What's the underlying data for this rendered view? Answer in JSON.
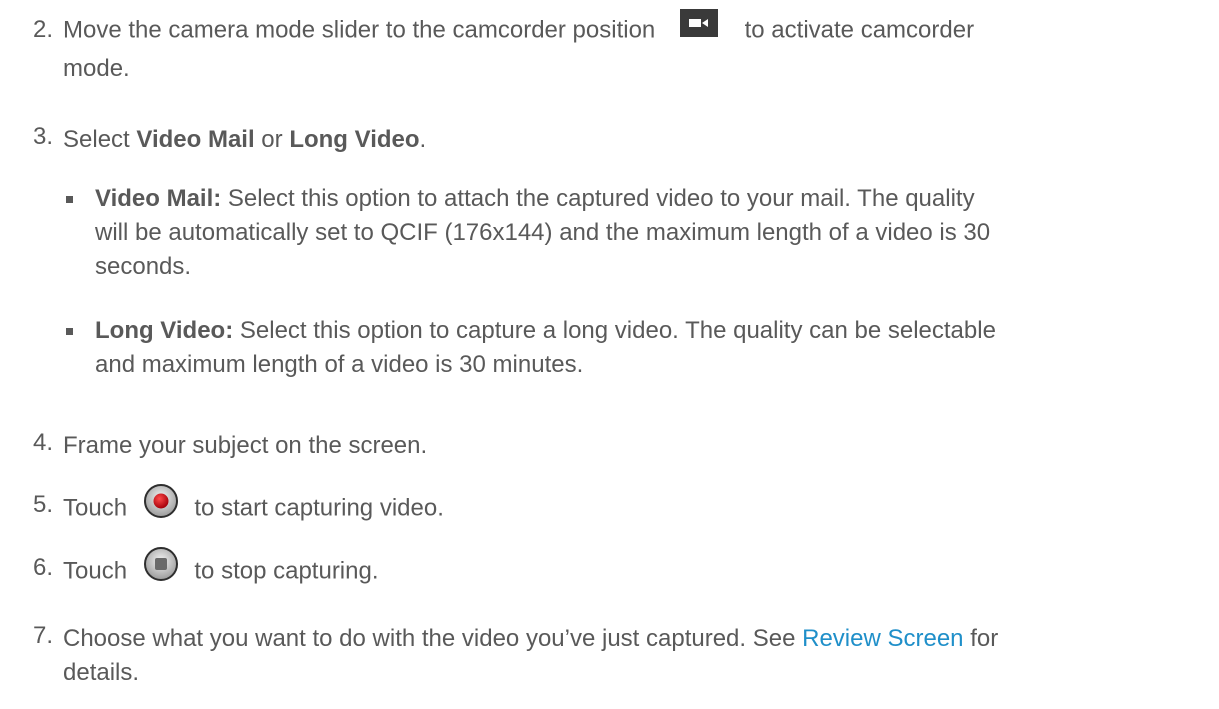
{
  "steps": [
    {
      "num": "2.",
      "pre": "Move the camera mode slider to the camcorder position",
      "post": "to activate camcorder",
      "line2": "mode.",
      "icon": "camcorder-icon"
    },
    {
      "num": "3.",
      "pre": "Select ",
      "b1": "Video Mail",
      "mid": " or ",
      "b2": "Long Video",
      "post": "."
    },
    {
      "num": "4.",
      "text": "Frame your subject on the screen."
    },
    {
      "num": "5.",
      "pre": "Touch",
      "post": "to start capturing video.",
      "icon": "record-button-icon"
    },
    {
      "num": "6.",
      "pre": "Touch",
      "post": "to stop capturing.",
      "icon": "stop-button-icon"
    },
    {
      "num": "7.",
      "line1": "Choose what you want to do with the video you’ve just captured. See ",
      "link": "Review Screen",
      "line1_post": " for",
      "line2": "details."
    }
  ],
  "bullets": [
    {
      "label": "Video Mail:",
      "line1": " Select this option to attach the captured video to your mail. The quality",
      "line2": "will be automatically set to QCIF (176x144) and the maximum length of a video is 30",
      "line3": "seconds."
    },
    {
      "label": "Long Video:",
      "line1": " Select this option to capture a long video. The quality can be selectable",
      "line2": "and maximum length of a video is 30 minutes."
    }
  ],
  "colors": {
    "text": "#595959",
    "link": "#1f8fc9",
    "record": "#c0101a"
  }
}
